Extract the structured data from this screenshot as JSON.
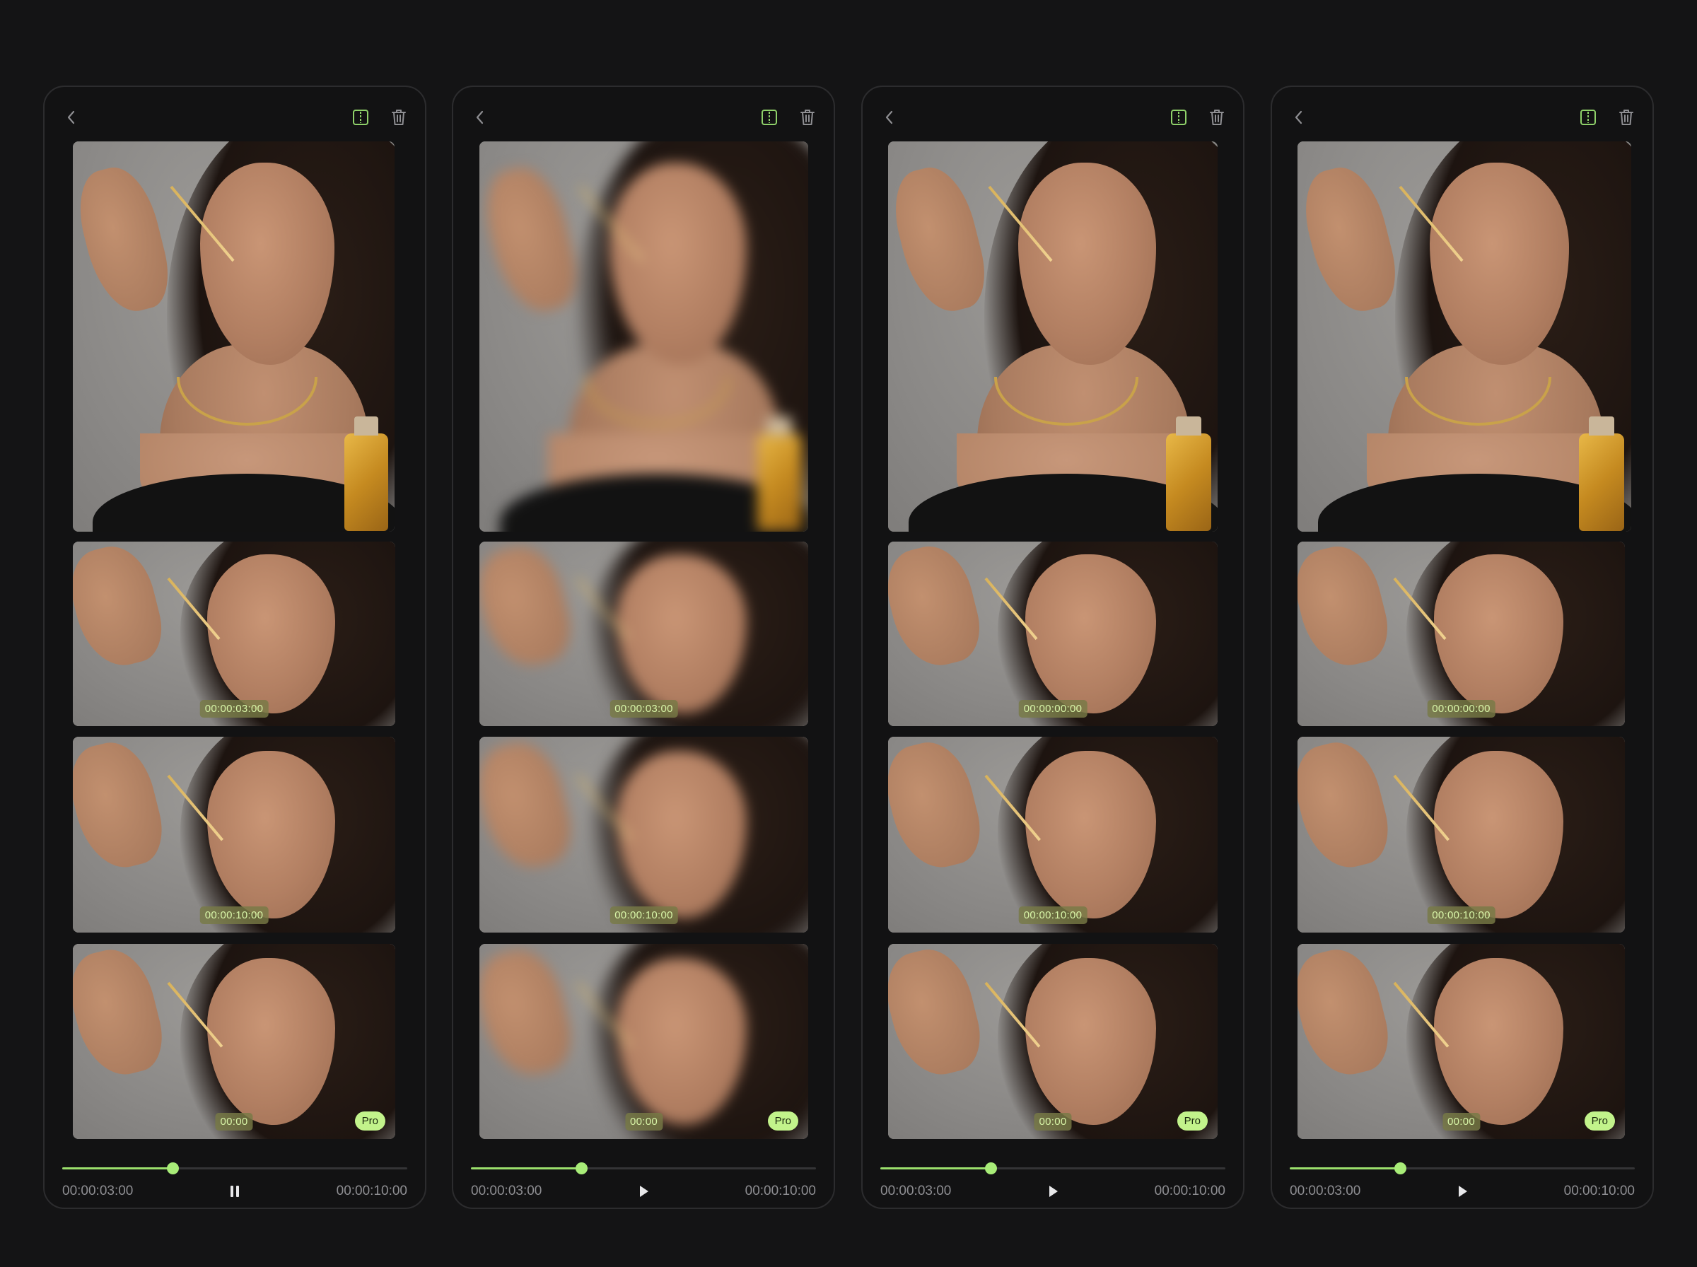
{
  "colors": {
    "background": "#141415",
    "accent": "#9be06c",
    "timestamp_text": "#d8f5a8",
    "pro_badge": "#c2f38b"
  },
  "screens": [
    {
      "back_icon": "chevron-left-icon",
      "compare_icon": "split-compare-icon",
      "delete_icon": "trash-icon",
      "main_frame": {
        "blurred": false
      },
      "thumbnails": [
        {
          "timestamp": "00:00:03:00"
        },
        {
          "timestamp": "00:00:10:00"
        },
        {
          "timestamp": "00:00",
          "badge": "Pro"
        }
      ],
      "player": {
        "current_time": "00:00:03:00",
        "total_time": "00:00:10:00",
        "progress": 0.32,
        "state_icon": "pause-icon"
      }
    },
    {
      "back_icon": "chevron-left-icon",
      "compare_icon": "split-compare-icon",
      "delete_icon": "trash-icon",
      "main_frame": {
        "blurred": true
      },
      "thumbnails": [
        {
          "timestamp": "00:00:03:00"
        },
        {
          "timestamp": "00:00:10:00"
        },
        {
          "timestamp": "00:00",
          "badge": "Pro"
        }
      ],
      "player": {
        "current_time": "00:00:03:00",
        "total_time": "00:00:10:00",
        "progress": 0.32,
        "state_icon": "play-icon"
      }
    },
    {
      "back_icon": "chevron-left-icon",
      "compare_icon": "split-compare-icon",
      "delete_icon": "trash-icon",
      "main_frame": {
        "blurred": false
      },
      "thumbnails": [
        {
          "timestamp": "00:00:00:00"
        },
        {
          "timestamp": "00:00:10:00"
        },
        {
          "timestamp": "00:00",
          "badge": "Pro"
        }
      ],
      "player": {
        "current_time": "00:00:03:00",
        "total_time": "00:00:10:00",
        "progress": 0.32,
        "state_icon": "play-icon"
      }
    },
    {
      "back_icon": "chevron-left-icon",
      "compare_icon": "split-compare-icon",
      "delete_icon": "trash-icon",
      "main_frame": {
        "blurred": false
      },
      "thumbnails": [
        {
          "timestamp": "00:00:00:00"
        },
        {
          "timestamp": "00:00:10:00"
        },
        {
          "timestamp": "00:00",
          "badge": "Pro"
        }
      ],
      "player": {
        "current_time": "00:00:03:00",
        "total_time": "00:00:10:00",
        "progress": 0.32,
        "state_icon": "play-icon"
      }
    }
  ]
}
